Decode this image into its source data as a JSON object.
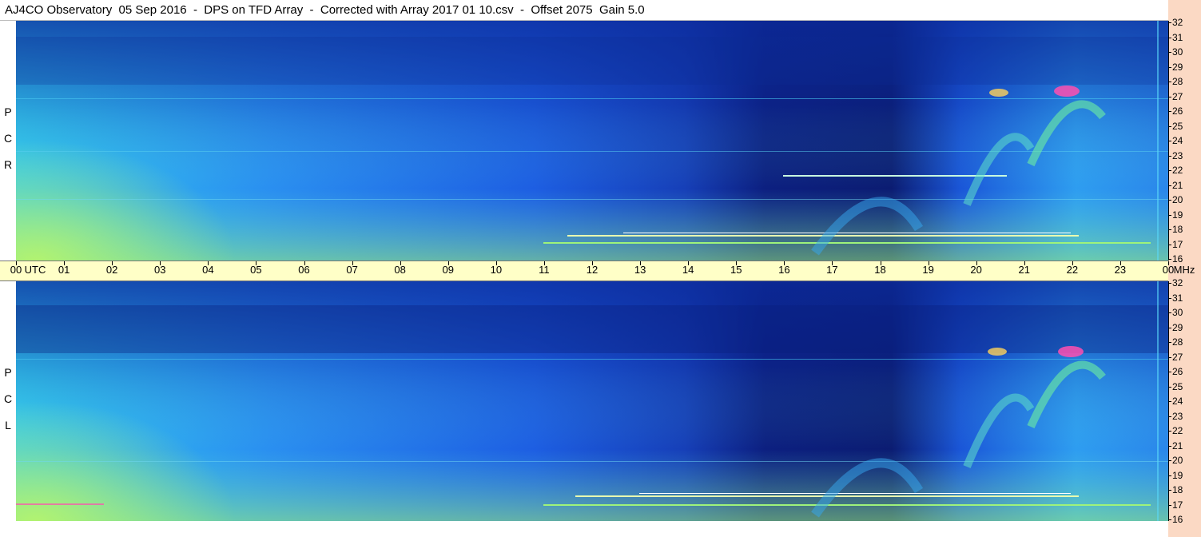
{
  "title": "AJ4CO Observatory  05 Sep 2016  -  DPS on TFD Array  -  Corrected with Array 2017 01 10.csv  -  Offset 2075  Gain 5.0",
  "panels": [
    {
      "id": "rcp",
      "letters": [
        "R",
        "C",
        "P"
      ]
    },
    {
      "id": "lcp",
      "letters": [
        "L",
        "C",
        "P"
      ]
    }
  ],
  "utc_axis": {
    "unit_label": "UTC",
    "unit_end": "MHz",
    "ticks": [
      "00",
      "01",
      "02",
      "03",
      "04",
      "05",
      "06",
      "07",
      "08",
      "09",
      "10",
      "11",
      "12",
      "13",
      "14",
      "15",
      "16",
      "17",
      "18",
      "19",
      "20",
      "21",
      "22",
      "23",
      "00"
    ]
  },
  "mhz_axis": {
    "ticks": [
      "32",
      "31",
      "30",
      "29",
      "28",
      "27",
      "26",
      "25",
      "24",
      "23",
      "22",
      "21",
      "20",
      "19",
      "18",
      "17",
      "16"
    ]
  },
  "colors": {
    "gutter": "#fbd9c4",
    "time_axis": "#ffffc7",
    "low_power": "#0a1f7a",
    "background": "#1e5fe0",
    "high_power": "#7cf5a0",
    "burst": "#ff3fa0"
  }
}
